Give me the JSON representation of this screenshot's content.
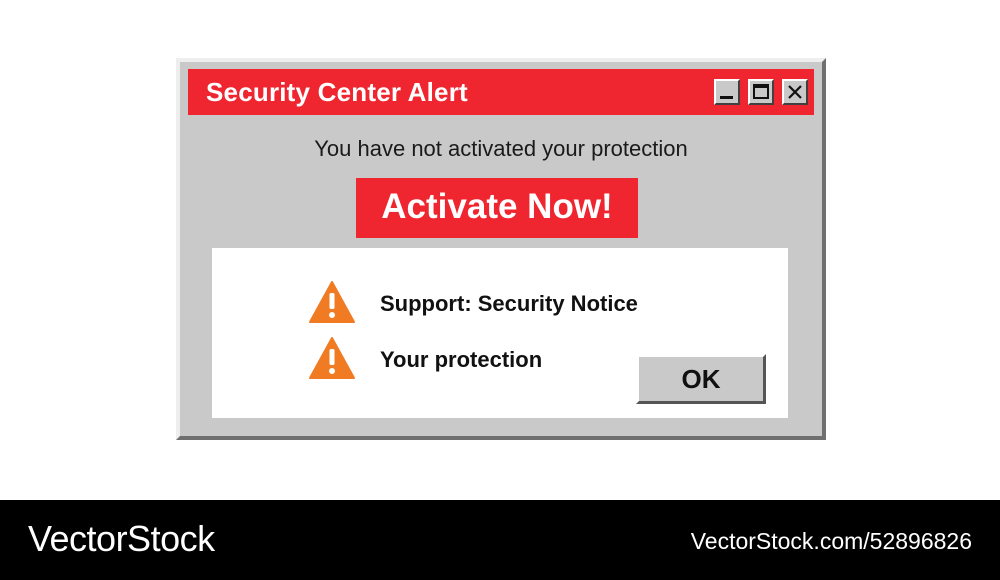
{
  "dialog": {
    "title": "Security Center Alert",
    "window_buttons": [
      "minimize",
      "maximize",
      "close"
    ],
    "subtitle": "You have not activated your protection",
    "activate_label": "Activate Now!",
    "notices": [
      {
        "icon": "warning-icon",
        "text": "Support: Security Notice"
      },
      {
        "icon": "warning-icon",
        "text": "Your protection"
      }
    ],
    "ok_label": "OK"
  },
  "footer": {
    "brand": "VectorStock",
    "image_id": "VectorStock.com/52896826"
  },
  "colors": {
    "accent": "#ef2630",
    "dialog_bg": "#c9c9c9",
    "warning": "#f07b22"
  }
}
